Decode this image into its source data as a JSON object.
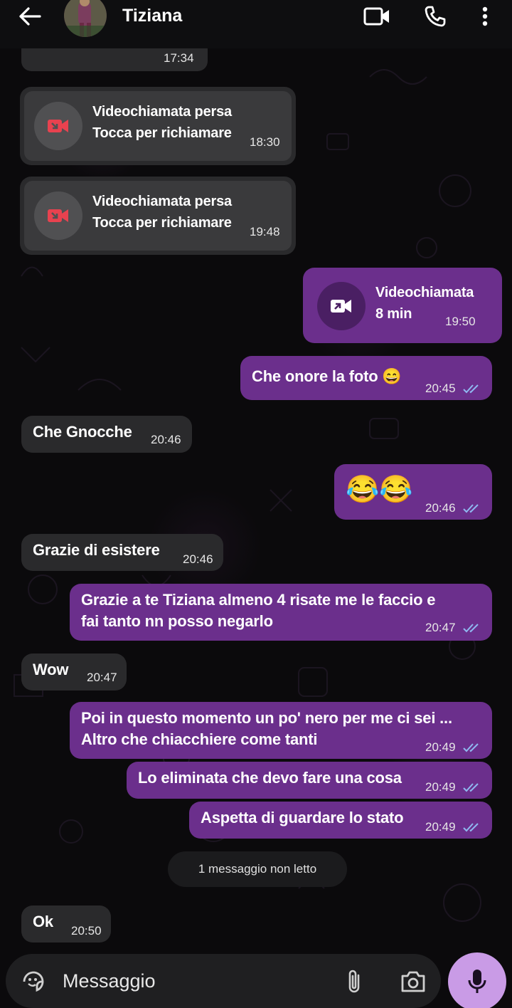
{
  "header": {
    "contact_name": "Tiziana"
  },
  "messages": {
    "partial_time": "17:34",
    "missed1": {
      "title": "Videochiamata persa",
      "subtitle": "Tocca per richiamare",
      "time": "18:30"
    },
    "missed2": {
      "title": "Videochiamata persa",
      "subtitle": "Tocca per richiamare",
      "time": "19:48"
    },
    "video_call": {
      "title": "Videochiamata",
      "duration": "8 min",
      "time": "19:50"
    },
    "m1": {
      "text": "Che onore la foto 😄",
      "time": "20:45"
    },
    "m2": {
      "text": "Che Gnocche",
      "time": "20:46"
    },
    "m3": {
      "text": "😂😂",
      "time": "20:46"
    },
    "m4": {
      "text": "Grazie di esistere",
      "time": "20:46"
    },
    "m5": {
      "line1": "Grazie a te Tiziana almeno 4 risate me le faccio e",
      "line2": "fai tanto nn posso negarlo",
      "time": "20:47"
    },
    "m6": {
      "text": "Wow",
      "time": "20:47"
    },
    "m7": {
      "line1": "Poi in questo momento un po' nero per me ci sei ...",
      "line2": "Altro che chiacchiere come tanti",
      "time": "20:49"
    },
    "m8": {
      "text": "Lo eliminata che devo fare una cosa",
      "time": "20:49"
    },
    "m9": {
      "text": "Aspetta di guardare lo stato",
      "time": "20:49"
    },
    "unread_label": "1 messaggio non letto",
    "m10": {
      "text": "Ok",
      "time": "20:50"
    }
  },
  "input": {
    "placeholder": "Messaggio"
  },
  "colors": {
    "outgoing_bubble": "#6b2f8c",
    "incoming_bubble": "#2a2a2c",
    "missed_call_red": "#e8424f",
    "read_ticks": "#8fb8f0",
    "mic_button": "#c99be6"
  },
  "icons": [
    "back-arrow-icon",
    "video-call-icon",
    "phone-icon",
    "more-vert-icon",
    "missed-video-icon",
    "outgoing-video-icon",
    "double-check-icon",
    "sticker-icon",
    "attach-icon",
    "camera-icon",
    "mic-icon"
  ]
}
